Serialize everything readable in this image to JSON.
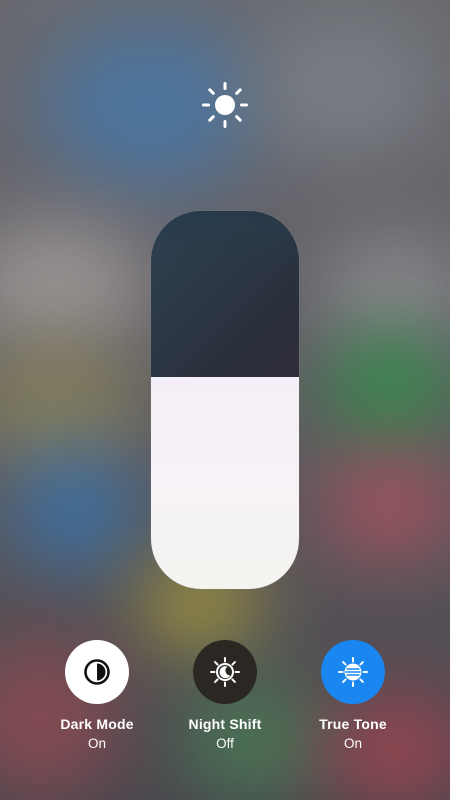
{
  "brightness": {
    "level_percent": 56
  },
  "controls": [
    {
      "label": "Dark Mode",
      "state": "On",
      "icon": "dark-mode-icon",
      "bg": "#ffffff",
      "fg": "#111111"
    },
    {
      "label": "Night Shift",
      "state": "Off",
      "icon": "night-shift-icon",
      "bg": "#2b2823",
      "fg": "#ffffff"
    },
    {
      "label": "True Tone",
      "state": "On",
      "icon": "true-tone-icon",
      "bg": "#1a86f0",
      "fg": "#ffffff"
    }
  ],
  "colors": {
    "accent_blue": "#1a86f0",
    "label_white": "#ffffff"
  }
}
